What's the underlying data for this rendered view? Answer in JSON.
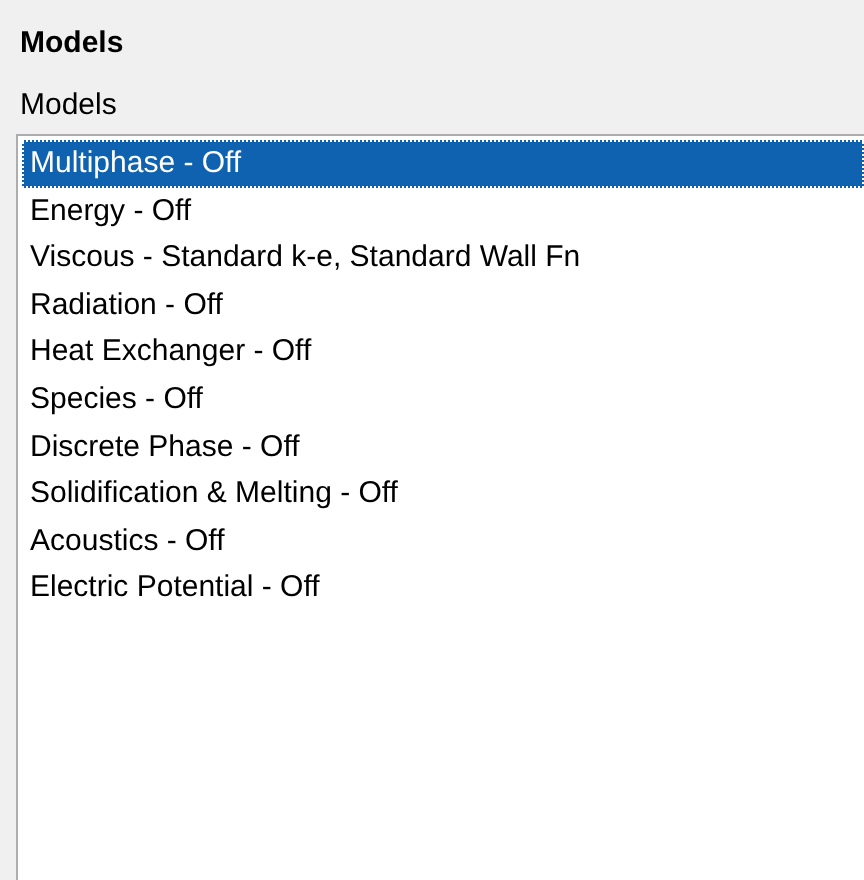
{
  "panel": {
    "title": "Models"
  },
  "list": {
    "label": "Models",
    "items": [
      {
        "text": "Multiphase - Off",
        "selected": true
      },
      {
        "text": "Energy - Off",
        "selected": false
      },
      {
        "text": "Viscous - Standard k-e, Standard Wall Fn",
        "selected": false
      },
      {
        "text": "Radiation - Off",
        "selected": false
      },
      {
        "text": "Heat Exchanger - Off",
        "selected": false
      },
      {
        "text": "Species - Off",
        "selected": false
      },
      {
        "text": "Discrete Phase - Off",
        "selected": false
      },
      {
        "text": "Solidification & Melting - Off",
        "selected": false
      },
      {
        "text": "Acoustics - Off",
        "selected": false
      },
      {
        "text": "Electric Potential - Off",
        "selected": false
      }
    ]
  }
}
